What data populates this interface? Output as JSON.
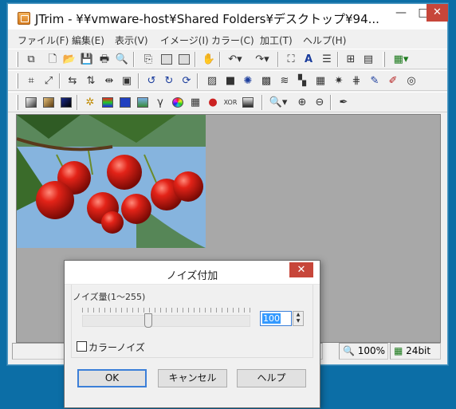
{
  "window": {
    "title": "JTrim - ¥¥vmware-host¥Shared Folders¥デスクトップ¥94...",
    "controls": {
      "minimize": "—",
      "maximize": "□",
      "close": "✕"
    }
  },
  "menubar": {
    "items": [
      "ファイル(F)",
      "編集(E)",
      "表示(V)",
      "イメージ(I)",
      "カラー(C)",
      "加工(T)",
      "ヘルプ(H)"
    ]
  },
  "toolbar": {
    "row1": [
      "new-window-icon",
      "new-icon",
      "open-icon",
      "save-icon",
      "print-icon",
      "print-preview-icon",
      "copy-icon",
      "paste-icon",
      "paste-new-icon",
      "hand-icon",
      "undo-icon",
      "redo-icon",
      "fit-window-icon",
      "text-icon",
      "align-icon",
      "grid-icon",
      "film-icon",
      "color-grid-icon"
    ],
    "row2": [
      "crop-icon",
      "resize-icon",
      "flip-horizontal-icon",
      "flip-vertical-icon",
      "mirror-icon",
      "frame-icon",
      "rotate-left-icon",
      "rotate-right-icon",
      "rotate-icon",
      "shadow-icon",
      "fill-icon",
      "sun-icon",
      "mosaic-icon",
      "wave-icon",
      "relief-icon",
      "bricks-icon",
      "emboss-icon",
      "warp-icon",
      "pen-icon",
      "edit-icon",
      "spiral-icon"
    ],
    "row3": [
      "grayscale-icon",
      "sepia-icon",
      "invert-icon",
      "sparkle-icon",
      "rgb-bars-icon",
      "blue-square-icon",
      "picture-icon",
      "gamma-icon",
      "color-wheel-icon",
      "checker-icon",
      "rgb-circles-icon",
      "xor-icon",
      "gradient-icon",
      "zoom-dropdown-icon",
      "zoom-in-icon",
      "zoom-out-icon",
      "eyedropper-icon"
    ]
  },
  "statusbar": {
    "zoom": "100%",
    "bits": "24bit"
  },
  "dialog": {
    "title": "ノイズ付加",
    "close": "✕",
    "slider_label": "ノイズ量(1〜255)",
    "value": "100",
    "value_fraction": 0.39,
    "checkbox_label": "カラーノイズ",
    "checkbox_checked": false,
    "buttons": {
      "ok": "OK",
      "cancel": "キャンセル",
      "help": "ヘルプ"
    }
  },
  "colors": {
    "desktop": "#0c6ea6",
    "close_button": "#c7463a",
    "canvas_background": "#a8a8a8",
    "selection": "#3399ff"
  }
}
